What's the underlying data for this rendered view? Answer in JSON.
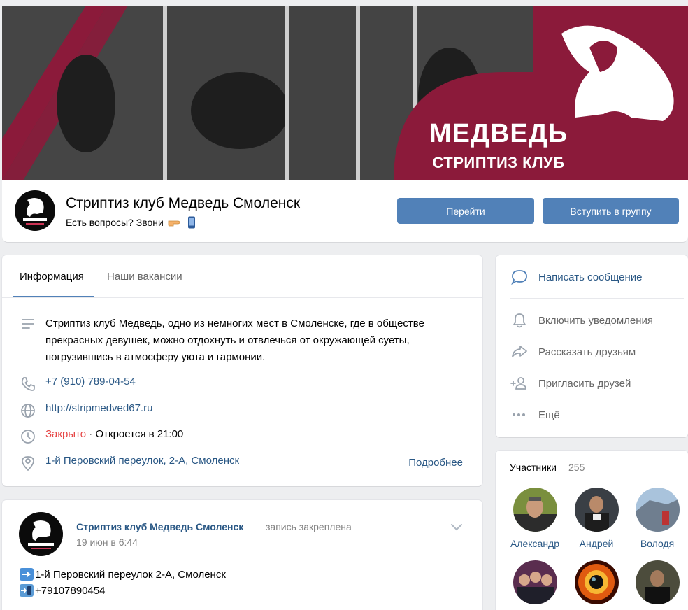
{
  "cover": {
    "title": "МЕДВЕДЬ",
    "subtitle": "СТРИПТИЗ КЛУБ",
    "colors": {
      "brand": "#8b1a3a",
      "dark": "#3a3a3a"
    }
  },
  "header": {
    "name": "Стриптиз клуб Медведь Смоленск",
    "status": "Есть вопросы? Звони",
    "status_icons": [
      "pointing-hand-icon",
      "mobile-phone-icon"
    ],
    "go_button": "Перейти",
    "join_button": "Вступить в группу"
  },
  "info": {
    "tabs": [
      {
        "label": "Информация",
        "active": true
      },
      {
        "label": "Наши вакансии",
        "active": false
      }
    ],
    "description": "Стриптиз клуб Медведь, одно из немногих мест в Смоленске, где в обществе прекрасных девушек, можно отдохнуть и отвлечься от окружающей суеты, погрузившись в атмосферу уюта и гармонии.",
    "phone": "+7 (910) 789-04-54",
    "website": "http://stripmedved67.ru",
    "hours_status": "Закрыто",
    "hours_sep": " · ",
    "hours_next": "Откроется в 21:00",
    "address": "1-й Перовский переулок, 2-А, Смоленск",
    "more": "Подробнее"
  },
  "post": {
    "author": "Стриптиз клуб Медведь Смоленск",
    "pinned": "запись закреплена",
    "date": "19 июн в 6:44",
    "line1": "1-й Перовский переулок 2-А, Смоленск",
    "line2": "+79107890454",
    "line_icons": [
      "right-arrow-icon",
      "mobile-phone-arrow-icon"
    ]
  },
  "actions": {
    "items": [
      {
        "label": "Написать сообщение",
        "icon": "message-icon"
      },
      {
        "label": "Включить уведомления",
        "icon": "bell-icon"
      },
      {
        "label": "Рассказать друзьям",
        "icon": "share-icon"
      },
      {
        "label": "Пригласить друзей",
        "icon": "add-user-icon"
      },
      {
        "label": "Ещё",
        "icon": "more-icon"
      }
    ]
  },
  "members": {
    "title": "Участники",
    "count": "255",
    "people": [
      {
        "name": "Александр"
      },
      {
        "name": "Андрей"
      },
      {
        "name": "Володя"
      },
      {
        "name": ""
      },
      {
        "name": ""
      },
      {
        "name": ""
      }
    ]
  }
}
